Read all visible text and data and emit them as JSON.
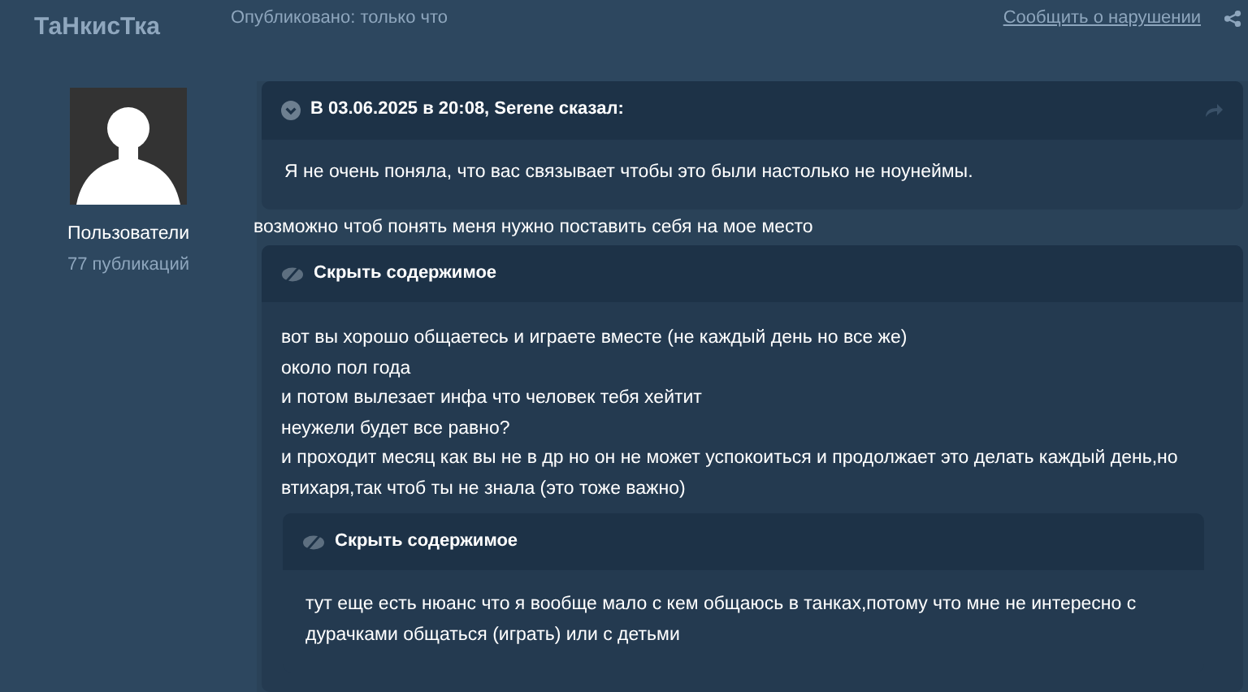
{
  "author": {
    "name": "ТаНкисТка",
    "role": "Пользователи",
    "post_count": "77 публикаций"
  },
  "post": {
    "published": "Опубликовано: только что",
    "report": "Сообщить о нарушении",
    "quote": {
      "header": "В 03.06.2025 в 20:08, Serene сказал:",
      "text": "Я не очень поняла, что вас связывает чтобы это были настолько не ноунеймы."
    },
    "text": "возможно чтоб понять меня нужно поставить себя на мое место",
    "spoiler": {
      "title": "Скрыть содержимое",
      "lines": [
        "вот вы хорошо общаетесь и играете вместе (не каждый день но все же)",
        "около пол года",
        "и потом вылезает инфа что человек тебя хейтит",
        "неужели будет все равно?",
        "и проходит месяц как вы не в др но он не может успокоиться и продолжает это делать каждый день,но втихаря,так чтоб ты не знала (это тоже важно)"
      ],
      "spoiler": {
        "title": "Скрыть содержимое",
        "lines": [
          "тут еще есть нюанс что я вообще мало с кем общаюсь в танках,потому что мне не интересно с дурачками общаться (играть) или с детьми"
        ]
      }
    }
  }
}
